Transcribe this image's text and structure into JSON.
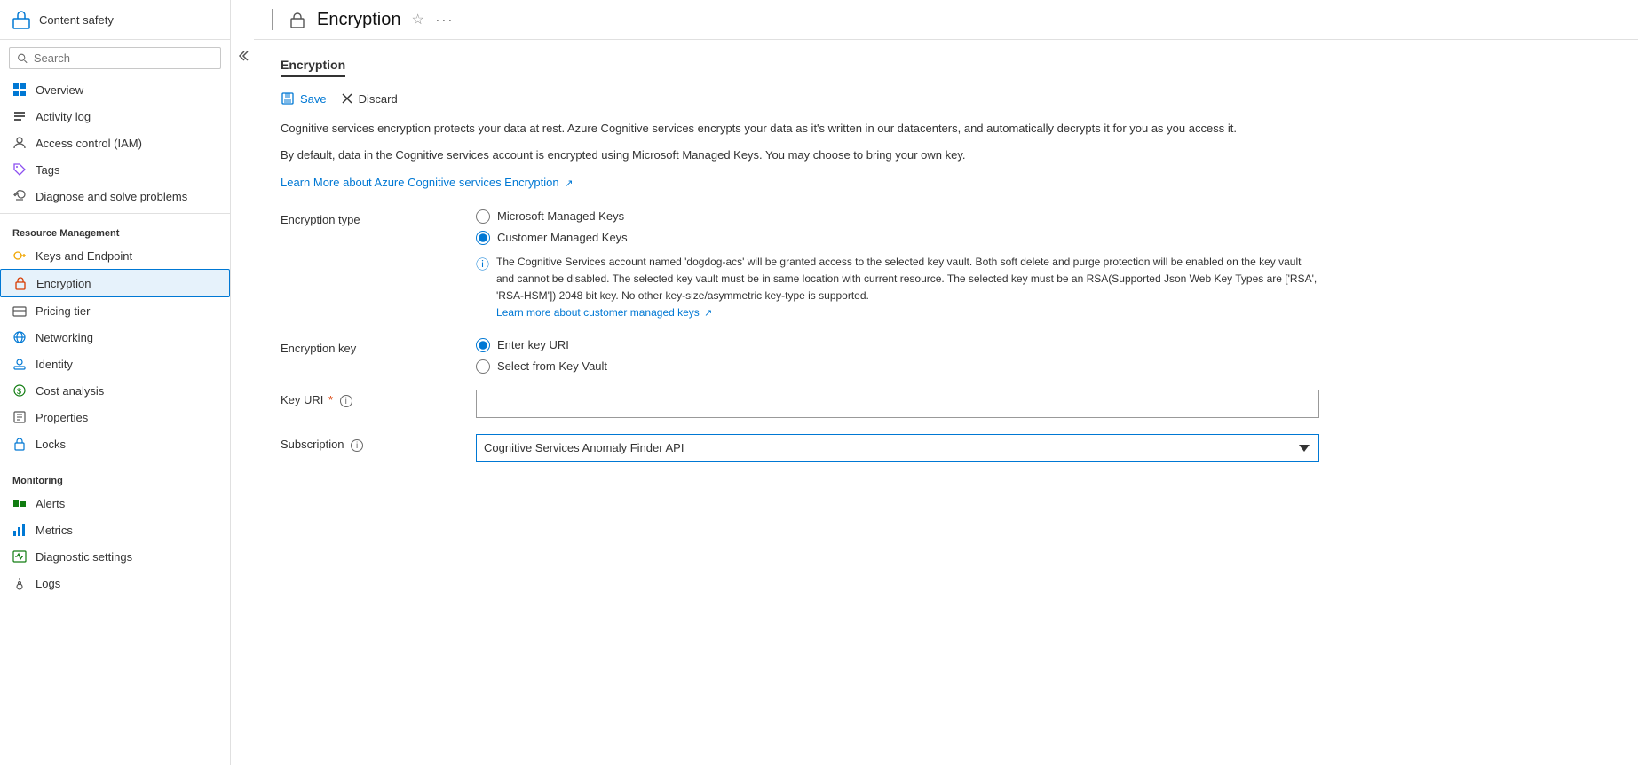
{
  "app": {
    "title": "Content safety",
    "page_title": "Encryption",
    "tab_label": "Encryption"
  },
  "search": {
    "placeholder": "Search"
  },
  "sidebar": {
    "sections": [
      {
        "items": [
          {
            "id": "overview",
            "label": "Overview",
            "icon": "grid-icon"
          },
          {
            "id": "activity-log",
            "label": "Activity log",
            "icon": "list-icon"
          },
          {
            "id": "access-control",
            "label": "Access control (IAM)",
            "icon": "person-icon"
          },
          {
            "id": "tags",
            "label": "Tags",
            "icon": "tag-icon"
          },
          {
            "id": "diagnose",
            "label": "Diagnose and solve problems",
            "icon": "wrench-icon"
          }
        ]
      },
      {
        "header": "Resource Management",
        "items": [
          {
            "id": "keys-endpoint",
            "label": "Keys and Endpoint",
            "icon": "key-icon"
          },
          {
            "id": "encryption",
            "label": "Encryption",
            "icon": "encryption-icon",
            "active": true
          },
          {
            "id": "pricing-tier",
            "label": "Pricing tier",
            "icon": "pricing-icon"
          },
          {
            "id": "networking",
            "label": "Networking",
            "icon": "network-icon"
          },
          {
            "id": "identity",
            "label": "Identity",
            "icon": "identity-icon"
          },
          {
            "id": "cost-analysis",
            "label": "Cost analysis",
            "icon": "cost-icon"
          },
          {
            "id": "properties",
            "label": "Properties",
            "icon": "properties-icon"
          },
          {
            "id": "locks",
            "label": "Locks",
            "icon": "lock-icon"
          }
        ]
      },
      {
        "header": "Monitoring",
        "items": [
          {
            "id": "alerts",
            "label": "Alerts",
            "icon": "alert-icon"
          },
          {
            "id": "metrics",
            "label": "Metrics",
            "icon": "metrics-icon"
          },
          {
            "id": "diagnostic-settings",
            "label": "Diagnostic settings",
            "icon": "diagnostic-icon"
          },
          {
            "id": "logs",
            "label": "Logs",
            "icon": "logs-icon"
          }
        ]
      }
    ]
  },
  "toolbar": {
    "save_label": "Save",
    "discard_label": "Discard"
  },
  "content": {
    "description1": "Cognitive services encryption protects your data at rest. Azure Cognitive services encrypts your data as it's written in our datacenters, and automatically decrypts it for you as you access it.",
    "description2": "By default, data in the Cognitive services account is encrypted using Microsoft Managed Keys. You may choose to bring your own key.",
    "learn_more_link": "Learn More about Azure Cognitive services Encryption",
    "encryption_type_label": "Encryption type",
    "radio_mmk": "Microsoft Managed Keys",
    "radio_cmk": "Customer Managed Keys",
    "info_text": "The Cognitive Services account named 'dogdog-acs' will be granted access to the selected key vault. Both soft delete and purge protection will be enabled on the key vault and cannot be disabled. The selected key vault must be in same location with current resource. The selected key must be an RSA(Supported Json Web Key Types are ['RSA', 'RSA-HSM']) 2048 bit key. No other key-size/asymmetric key-type is supported.",
    "learn_more_cmk_link": "Learn more about customer managed keys",
    "encryption_key_label": "Encryption key",
    "radio_enter_uri": "Enter key URI",
    "radio_key_vault": "Select from Key Vault",
    "key_uri_label": "Key URI",
    "key_uri_required": "*",
    "key_uri_placeholder": "",
    "subscription_label": "Subscription",
    "subscription_value": "Cognitive Services Anomaly Finder API",
    "subscription_options": [
      "Cognitive Services Anomaly Finder API"
    ]
  },
  "icons": {
    "save": "💾",
    "discard": "✕",
    "external_link": "↗",
    "info": "ℹ",
    "chevron_down": "▾",
    "chevron_left_right": "«"
  }
}
